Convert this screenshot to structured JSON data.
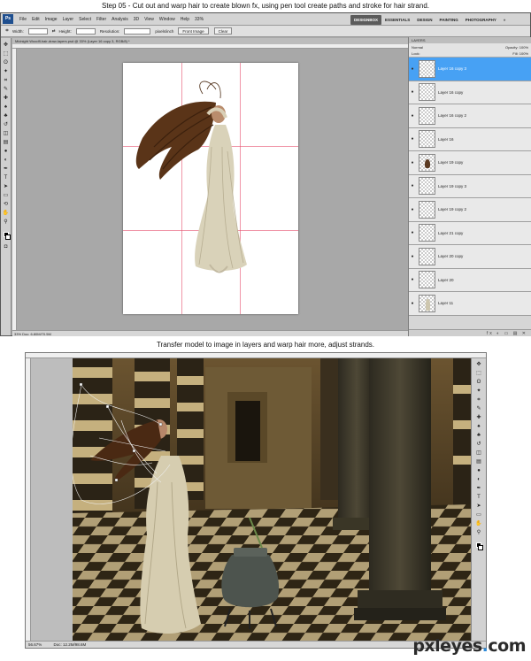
{
  "captions": {
    "step_caption": "Step 05 - Cut out and warp hair to create blown fx, using pen tool create paths and stroke for hair strand.",
    "transfer_caption": "Transfer model to image in layers and warp hair more, adjust strands."
  },
  "window1": {
    "app_logo": "Ps",
    "menu": [
      "File",
      "Edit",
      "Image",
      "Layer",
      "Select",
      "Filter",
      "Analysis",
      "3D",
      "View",
      "Window",
      "Help"
    ],
    "zoom_menu": "33%",
    "workspaces": [
      "DESIGNBOX",
      "ESSENTIALS",
      "DESIGN",
      "PAINTING",
      "PHOTOGRAPHY"
    ],
    "workspace_more": "»",
    "options": {
      "width_label": "Width:",
      "height_label": "Height:",
      "resolution_label": "Resolution:",
      "resolution_unit": "pixels/inch",
      "front_image_button": "Front Image",
      "clear_button": "Clear"
    },
    "doc_tab": "Midnight Woodfl-hair-draw-layers.psd @ 33% (Layer 16 copy 3, RGB/8) *",
    "status": "33%    Doc: 6.80M/70.5M",
    "layers_panel": {
      "tab": "LAYERS",
      "blend_mode": "Normal",
      "opacity_label": "Opacity:",
      "opacity": "100%",
      "lock_label": "Lock:",
      "fill_label": "Fill:",
      "fill": "100%",
      "layers": [
        {
          "name": "Layer 16 copy 3",
          "selected": true
        },
        {
          "name": "Layer 16 copy",
          "selected": false
        },
        {
          "name": "Layer 16 copy 2",
          "selected": false
        },
        {
          "name": "Layer 16",
          "selected": false
        },
        {
          "name": "Layer 19 copy",
          "selected": false
        },
        {
          "name": "Layer 19 copy 3",
          "selected": false
        },
        {
          "name": "Layer 19 copy 2",
          "selected": false
        },
        {
          "name": "Layer 21 copy",
          "selected": false
        },
        {
          "name": "Layer 20 copy",
          "selected": false
        },
        {
          "name": "Layer 20",
          "selected": false
        },
        {
          "name": "Layer 11",
          "selected": false
        }
      ],
      "footer": "fx ◐ ▭ ▤ ✕"
    }
  },
  "window2": {
    "zoom": "56.67%",
    "doc_size": "Doc: 12.2M/98.6M"
  },
  "watermark": {
    "text_a": "pxleyes",
    "dot": ".",
    "text_b": "com"
  },
  "colors": {
    "selection_blue": "#47a1f4",
    "guide_pink": "#e6506e",
    "watermark_blue": "#2d8ad8"
  }
}
